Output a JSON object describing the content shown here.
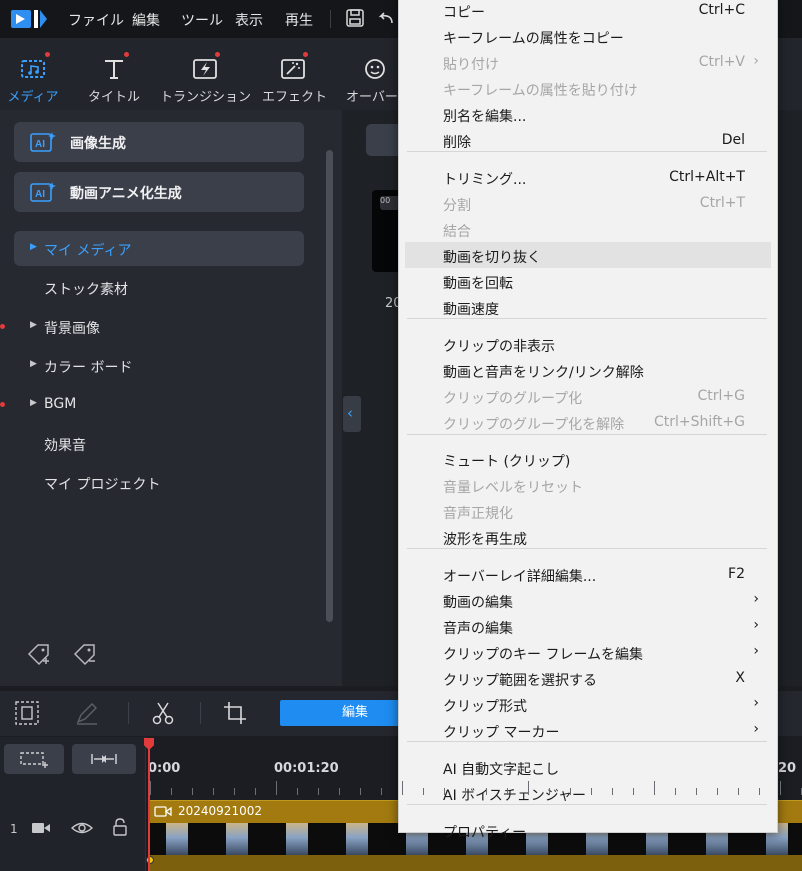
{
  "menubar": {
    "items": [
      "ファイル",
      "編集",
      "ツール",
      "表示",
      "再生"
    ]
  },
  "ribbon": {
    "tabs": [
      {
        "label": "メディア",
        "active": true
      },
      {
        "label": "タイトル",
        "active": false
      },
      {
        "label": "トランジション",
        "active": false
      },
      {
        "label": "エフェクト",
        "active": false
      },
      {
        "label": "オーバーレ",
        "active": false
      }
    ]
  },
  "left_panel": {
    "ai_buttons": [
      "画像生成",
      "動画アニメ化生成"
    ],
    "ai_badge": "AI",
    "nav": [
      {
        "label": "マイ メディア",
        "active": true,
        "expandable": true
      },
      {
        "label": "ストック素材",
        "active": false,
        "expandable": false
      },
      {
        "label": "背景画像",
        "active": false,
        "expandable": true
      },
      {
        "label": "カラー ボード",
        "active": false,
        "expandable": true
      },
      {
        "label": "BGM",
        "active": false,
        "expandable": true
      },
      {
        "label": "効果音",
        "active": false,
        "expandable": false
      },
      {
        "label": "マイ プロジェクト",
        "active": false,
        "expandable": false
      }
    ]
  },
  "media": {
    "thumb_badge": "00",
    "caption": "20"
  },
  "timeline_toolbar": {
    "edit_label": "編集"
  },
  "timeline": {
    "ruler_labels": [
      "0:00",
      "00:01:20",
      "20"
    ],
    "track_number": "1",
    "clip_name": "20240921002"
  },
  "context_menu": {
    "items": [
      {
        "label": "コピー",
        "shortcut": "Ctrl+C",
        "disabled": false
      },
      {
        "label": "キーフレームの属性をコピー",
        "shortcut": "",
        "disabled": false
      },
      {
        "label": "貼り付け",
        "shortcut": "Ctrl+V",
        "disabled": true,
        "submenu": true
      },
      {
        "label": "キーフレームの属性を貼り付け",
        "shortcut": "",
        "disabled": true
      },
      {
        "label": "別名を編集...",
        "shortcut": "",
        "disabled": false
      },
      {
        "label": "削除",
        "shortcut": "Del",
        "disabled": false
      },
      {
        "label": "トリミング...",
        "shortcut": "Ctrl+Alt+T",
        "disabled": false
      },
      {
        "label": "分割",
        "shortcut": "Ctrl+T",
        "disabled": true
      },
      {
        "label": "結合",
        "shortcut": "",
        "disabled": true
      },
      {
        "label": "動画を切り抜く",
        "shortcut": "",
        "disabled": false,
        "hover": true
      },
      {
        "label": "動画を回転",
        "shortcut": "",
        "disabled": false
      },
      {
        "label": "動画速度",
        "shortcut": "",
        "disabled": false
      },
      {
        "label": "クリップの非表示",
        "shortcut": "",
        "disabled": false
      },
      {
        "label": "動画と音声をリンク/リンク解除",
        "shortcut": "",
        "disabled": false
      },
      {
        "label": "クリップのグループ化",
        "shortcut": "Ctrl+G",
        "disabled": true
      },
      {
        "label": "クリップのグループ化を解除",
        "shortcut": "Ctrl+Shift+G",
        "disabled": true
      },
      {
        "label": "ミュート (クリップ)",
        "shortcut": "",
        "disabled": false
      },
      {
        "label": "音量レベルをリセット",
        "shortcut": "",
        "disabled": true
      },
      {
        "label": "音声正規化",
        "shortcut": "",
        "disabled": true
      },
      {
        "label": "波形を再生成",
        "shortcut": "",
        "disabled": false
      },
      {
        "label": "オーバーレイ詳細編集...",
        "shortcut": "F2",
        "disabled": false
      },
      {
        "label": "動画の編集",
        "shortcut": "",
        "disabled": false,
        "submenu": true
      },
      {
        "label": "音声の編集",
        "shortcut": "",
        "disabled": false,
        "submenu": true
      },
      {
        "label": "クリップのキー フレームを編集",
        "shortcut": "",
        "disabled": false,
        "submenu": true
      },
      {
        "label": "クリップ範囲を選択する",
        "shortcut": "X",
        "disabled": false
      },
      {
        "label": "クリップ形式",
        "shortcut": "",
        "disabled": false,
        "submenu": true
      },
      {
        "label": "クリップ マーカー",
        "shortcut": "",
        "disabled": false,
        "submenu": true
      },
      {
        "label": "AI 自動文字起こし",
        "shortcut": "",
        "disabled": false
      },
      {
        "label": "AI ボイスチェンジャー",
        "shortcut": "",
        "disabled": false
      },
      {
        "label": "プロパティー",
        "shortcut": "",
        "disabled": false
      }
    ]
  },
  "colors": {
    "accent": "#3aa0ff",
    "edit_button": "#1e8cf0",
    "notify_dot": "#e23b3b",
    "clip": "#a27a10"
  }
}
